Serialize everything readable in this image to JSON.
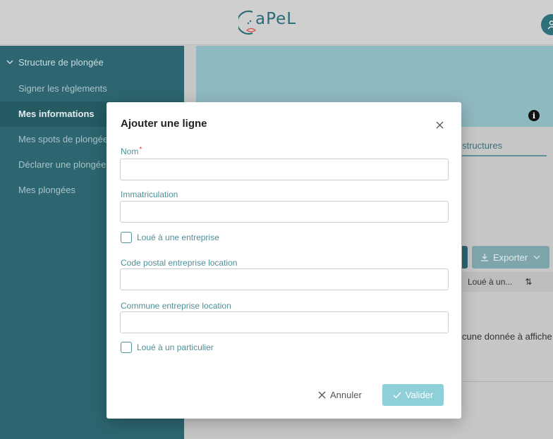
{
  "header": {
    "logo_text": "aPeL",
    "avatar_icon": "user-icon"
  },
  "sidebar": {
    "section_label": "Structure de plongée",
    "items": [
      {
        "label": "Signer les règlements",
        "active": false
      },
      {
        "label": "Mes informations",
        "active": true
      },
      {
        "label": "Mes spots de plongée",
        "active": false
      },
      {
        "label": "Déclarer une plongée",
        "active": false
      },
      {
        "label": "Mes plongées",
        "active": false
      }
    ]
  },
  "background": {
    "tab_label": "structures",
    "export_label": "Exporter",
    "column_header": "Loué à un...",
    "empty_text": "cune donnée à affiche"
  },
  "modal": {
    "title": "Ajouter une ligne",
    "fields": {
      "nom": {
        "label": "Nom",
        "required_mark": "*",
        "value": ""
      },
      "immatriculation": {
        "label": "Immatriculation",
        "value": ""
      },
      "loue_entreprise": {
        "label": "Loué à une entreprise",
        "checked": false
      },
      "code_postal": {
        "label": "Code postal entreprise location",
        "value": ""
      },
      "commune": {
        "label": "Commune entreprise location",
        "value": ""
      },
      "loue_particulier": {
        "label": "Loué à un particulier",
        "checked": false
      }
    },
    "cancel_label": "Annuler",
    "validate_label": "Valider"
  },
  "colors": {
    "sidebar": "#2d6670",
    "accent": "#4f8f98",
    "validate_button": "#8fcfd8"
  }
}
